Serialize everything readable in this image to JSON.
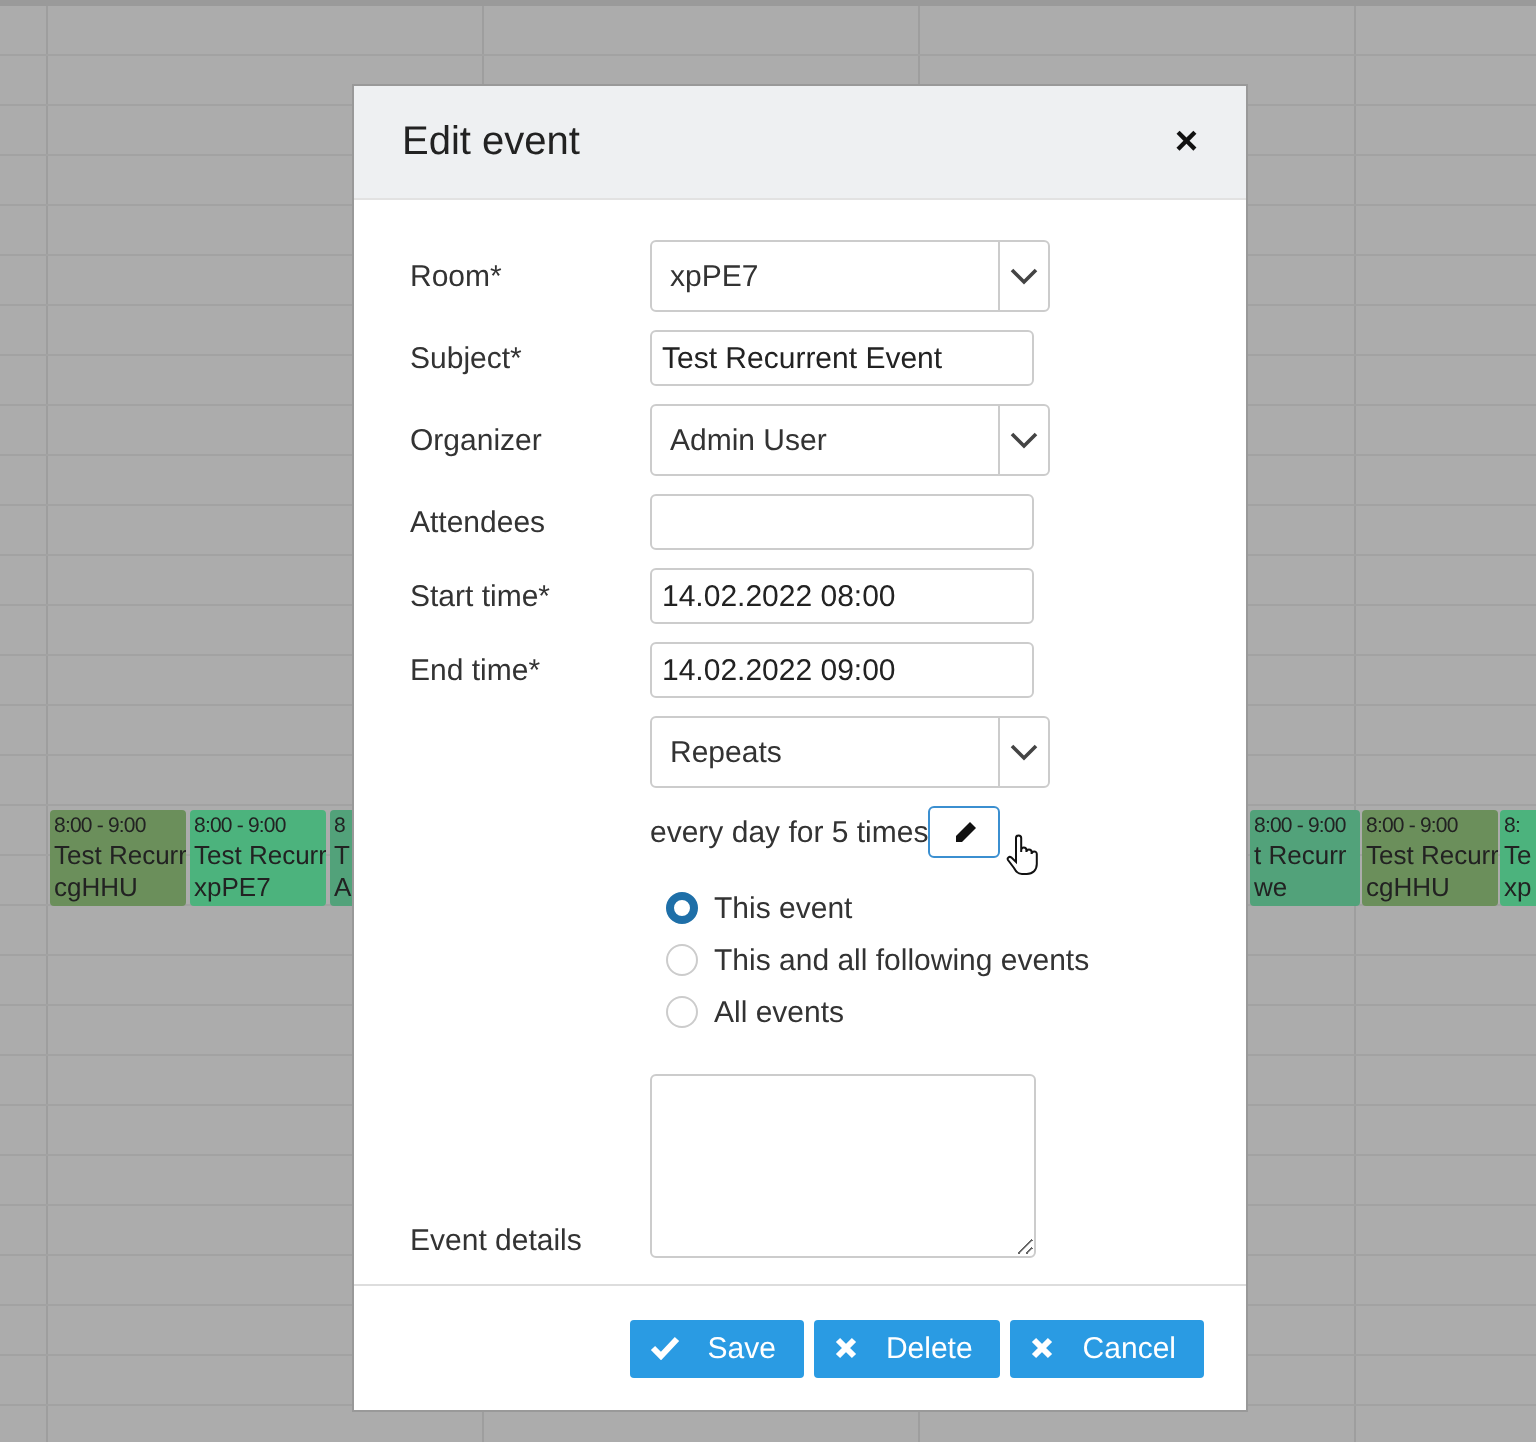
{
  "calendar": {
    "events": [
      {
        "time": "8:00 - 9:00",
        "title": "Test Recurr",
        "room": "cgHHU",
        "color": "#6b8f5b"
      },
      {
        "time": "8:00 - 9:00",
        "title": "Test Recurr",
        "room": "xpPE7",
        "color": "#4cb37d"
      },
      {
        "time": "8",
        "title": "T",
        "room": "A",
        "color": "#52a27a"
      },
      {
        "time": "8:00 - 9:00",
        "title": "t Recurr",
        "room": "we",
        "color": "#52a27a"
      },
      {
        "time": "8:00 - 9:00",
        "title": "Test Recurr",
        "room": "cgHHU",
        "color": "#6b8f5b"
      },
      {
        "time": "8:",
        "title": "Te",
        "room": "xp",
        "color": "#4cb37d"
      }
    ]
  },
  "dialog": {
    "title": "Edit event",
    "close": "×",
    "fields": [
      {
        "kind": "select",
        "label": "Room*",
        "value": "xpPE7"
      },
      {
        "kind": "input",
        "label": "Subject*",
        "value": "Test Recurrent Event"
      },
      {
        "kind": "select",
        "label": "Organizer",
        "value": "Admin User"
      },
      {
        "kind": "input",
        "label": "Attendees"
      },
      {
        "kind": "input",
        "label": "Start time*",
        "value": "14.02.2022 08:00"
      },
      {
        "kind": "input",
        "label": "End time*",
        "value": "14.02.2022 09:00"
      },
      {
        "kind": "select",
        "value": "Repeats"
      }
    ],
    "recurrence": "every day for 5 times",
    "scope": [
      {
        "label": "This event",
        "selected": true
      },
      {
        "label": "This and all following events",
        "selected": false
      },
      {
        "label": "All events",
        "selected": false
      }
    ],
    "details_label": "Event details",
    "buttons": [
      {
        "kind": "save",
        "label": "Save"
      },
      {
        "kind": "delete",
        "label": "Delete"
      },
      {
        "kind": "cancel",
        "label": "Cancel"
      }
    ]
  }
}
